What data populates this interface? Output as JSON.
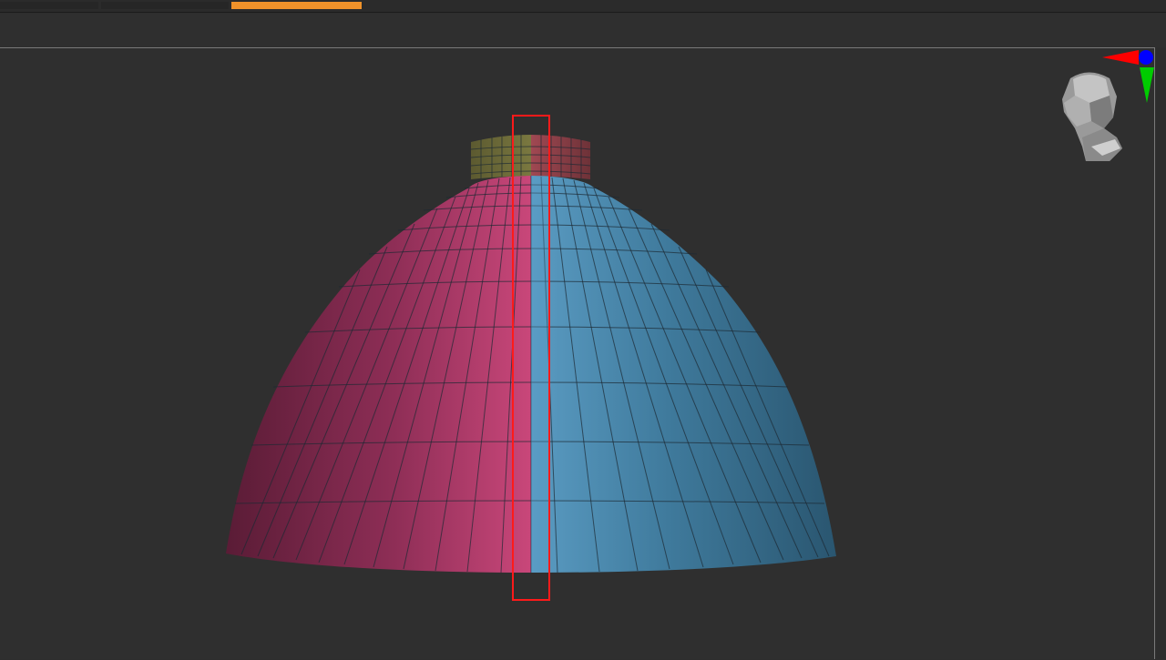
{
  "app": {
    "tabs": [
      {
        "state": "inactive"
      },
      {
        "state": "inactive"
      },
      {
        "state": "active"
      }
    ],
    "accent_color": "#f0922a"
  },
  "viewport": {
    "model": {
      "shape": "dome mesh with cylindrical neck",
      "left_polygroup_color": "#b43a68",
      "right_polygroup_color": "#4a88ad",
      "neck_left_color": "#6b6a3a",
      "neck_right_color": "#8a3e44"
    },
    "selection_box_color": "#ff1a1a",
    "navigator": {
      "icon": "head-icon",
      "axes": [
        {
          "axis": "x",
          "color": "#ff0000"
        },
        {
          "axis": "y",
          "color": "#00cc00"
        },
        {
          "axis": "z",
          "color": "#0000ff"
        }
      ]
    }
  }
}
